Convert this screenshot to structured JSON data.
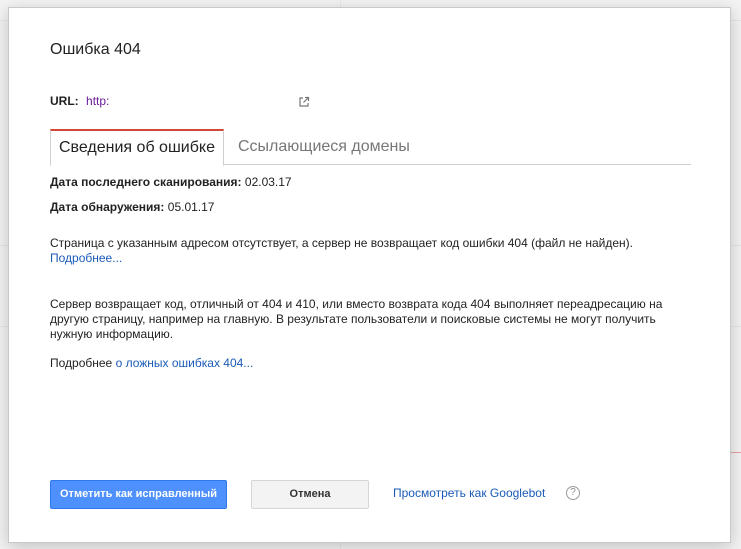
{
  "dialog": {
    "title": "Ошибка 404",
    "url": {
      "label": "URL:",
      "value": "http:"
    },
    "tabs": [
      {
        "label": "Сведения об ошибке",
        "active": true
      },
      {
        "label": "Ссылающиеся домены",
        "active": false
      }
    ],
    "details": {
      "last_crawl_label": "Дата последнего сканирования:",
      "last_crawl_value": "02.03.17",
      "detected_label": "Дата обнаружения:",
      "detected_value": "05.01.17"
    },
    "description": {
      "text": "Страница с указанным адресом отсутствует, а сервер не возвращает код ошибки 404 (файл не найден).",
      "more_link": "Подробнее..."
    },
    "soft404": {
      "text": "Сервер возвращает код, отличный от 404 и 410, или вместо возврата кода 404 выполняет переадресацию на другую страницу, например на главную. В результате пользователи и поисковые системы не могут получить нужную информацию.",
      "more_prefix": "Подробнее",
      "more_link": "о ложных ошибках 404..."
    },
    "buttons": {
      "mark_fixed": "Отметить как исправленный",
      "cancel": "Отмена",
      "fetch_as_googlebot": "Просмотреть как Googlebot"
    },
    "icons": {
      "external": "external-link-icon",
      "help": "help-icon"
    },
    "colors": {
      "primary_button": "#4d90fe",
      "active_tab_accent": "#d14836",
      "link": "#1a5bb8",
      "url_link": "#6a1b9a"
    }
  }
}
